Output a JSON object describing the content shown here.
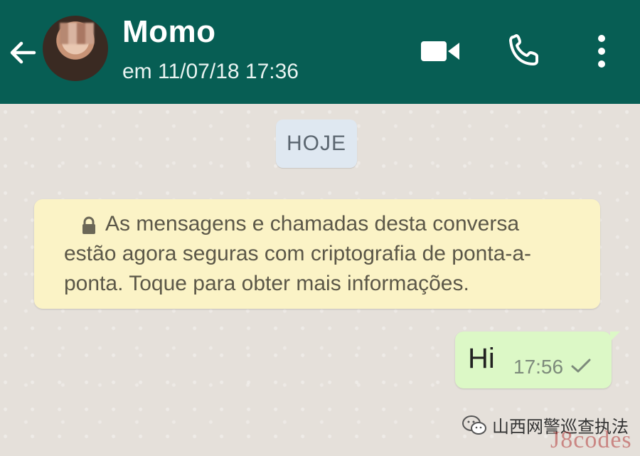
{
  "header": {
    "contact_name": "Momo",
    "status": "em 11/07/18 17:36",
    "color": "#075e54",
    "icons": [
      "back-arrow-icon",
      "video-call-icon",
      "phone-icon",
      "more-vert-icon"
    ]
  },
  "chat": {
    "date_chip": "HOJE",
    "encryption_notice": {
      "line1": "As mensagens e chamadas desta conversa",
      "line2": "estão agora seguras com criptografia de ponta-a-",
      "line3": "ponta. Toque para obter mais informações."
    },
    "messages": [
      {
        "text": "Hi",
        "time": "17:56",
        "status": "sent"
      }
    ]
  },
  "watermark": {
    "account": "山西网警巡查执法",
    "site": "J8codes"
  }
}
